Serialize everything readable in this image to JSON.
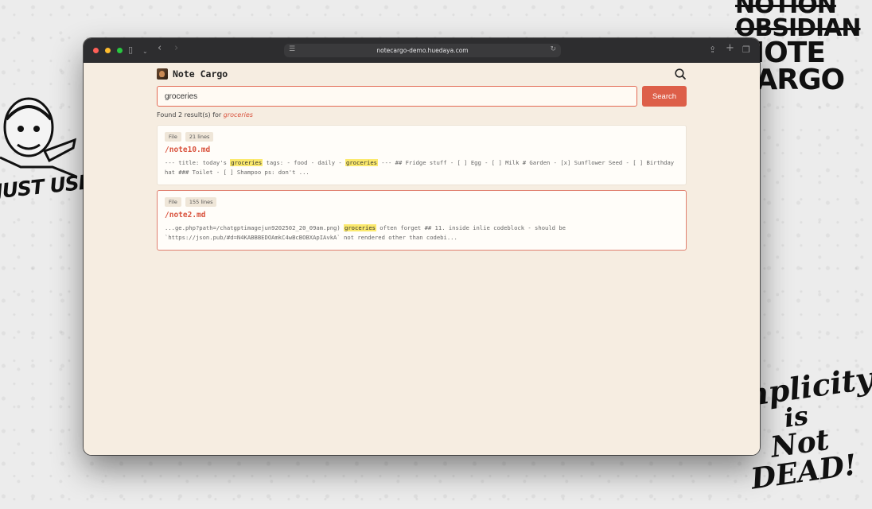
{
  "background": {
    "stack_words": [
      "NOTION",
      "OBSIDIAN",
      "NOTE",
      "CARGO"
    ],
    "left_text": "JUST USE.MI",
    "right_lines": [
      "implicity",
      "is",
      "Not DEAD!"
    ]
  },
  "browser": {
    "url": "notecargo-demo.huedaya.com"
  },
  "app": {
    "title": "Note Cargo",
    "search": {
      "value": "groceries",
      "placeholder": "",
      "button_label": "Search"
    },
    "results_summary": {
      "prefix": "Found 2 result(s) for",
      "query": "groceries"
    },
    "results": [
      {
        "type_label": "File",
        "lines_label": "21 lines",
        "path": "/note10.md",
        "snippet": [
          {
            "text": "--- title: today's ",
            "hl": false
          },
          {
            "text": "groceries",
            "hl": true
          },
          {
            "text": " tags: - food - daily - ",
            "hl": false
          },
          {
            "text": "groceries",
            "hl": true
          },
          {
            "text": " --- ## Fridge stuff - [ ] Egg - [ ] Milk # Garden - [x] Sunflower Seed - [ ] Birthday hat ### Toilet - [ ] Shampoo ps: don't ...",
            "hl": false
          }
        ]
      },
      {
        "type_label": "File",
        "lines_label": "155 lines",
        "path": "/note2.md",
        "snippet": [
          {
            "text": "...ge.php?path=/chatgptimagejun9202502_20_09am.png) ",
            "hl": false
          },
          {
            "text": "groceries",
            "hl": true
          },
          {
            "text": " often forget ## 11. inside inlie codeblock - should be `https://json.pub/#d=N4KABBBEDOAmkC4wBcBOBXApIAvkA` not rendered other than codebi...",
            "hl": false
          }
        ]
      }
    ]
  },
  "colors": {
    "accent": "#dd5f49",
    "highlight": "#fbe96d",
    "page_bg": "#f6ede1"
  }
}
